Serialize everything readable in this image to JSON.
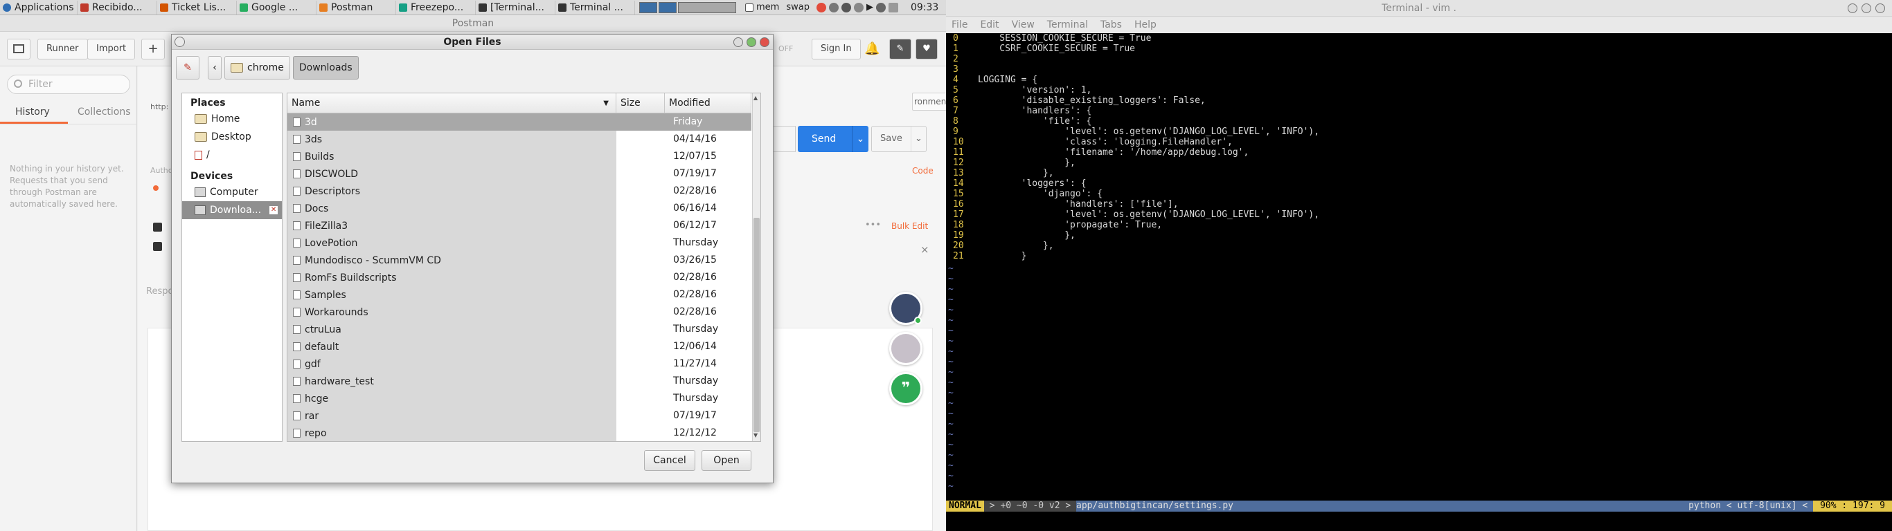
{
  "taskbar": {
    "apps": "Applications",
    "items": [
      {
        "label": "Recibido...",
        "color": "#c0392b"
      },
      {
        "label": "Ticket Lis...",
        "color": "#d35400"
      },
      {
        "label": "Google ...",
        "color": "#27ae60"
      },
      {
        "label": "Postman",
        "color": "#e67e22"
      },
      {
        "label": "Freezepo...",
        "color": "#16a085"
      },
      {
        "label": "[Terminal...",
        "color": "#333333"
      },
      {
        "label": "Terminal ...",
        "color": "#333333"
      }
    ],
    "mem": "mem",
    "swap": "swap",
    "clock": "09:33"
  },
  "postman": {
    "title": "Postman",
    "runner": "Runner",
    "import": "Import",
    "signin": "Sign In",
    "off": "OFF",
    "filter_placeholder": "Filter",
    "tab_history": "History",
    "tab_collections": "Collections",
    "empty": "Nothing in your history yet. Requests that you send through Postman are automatically saved here.",
    "send": "Send",
    "save": "Save",
    "code": "Code",
    "bulk_edit": "Bulk Edit",
    "environment": "ronment",
    "url_partial": "http:",
    "auth_partial": "Authc",
    "resp_partial": "Respo"
  },
  "dialog": {
    "title": "Open Files",
    "path": [
      "chrome",
      "Downloads"
    ],
    "places_header": "Places",
    "places": [
      "Home",
      "Desktop",
      "/"
    ],
    "devices_header": "Devices",
    "devices": [
      "Computer",
      "Downloa..."
    ],
    "columns": {
      "name": "Name",
      "size": "Size",
      "modified": "Modified"
    },
    "files": [
      {
        "name": "3d",
        "modified": "Friday"
      },
      {
        "name": "3ds",
        "modified": "04/14/16"
      },
      {
        "name": "Builds",
        "modified": "12/07/15"
      },
      {
        "name": "DISCWOLD",
        "modified": "07/19/17"
      },
      {
        "name": "Descriptors",
        "modified": "02/28/16"
      },
      {
        "name": "Docs",
        "modified": "06/16/14"
      },
      {
        "name": "FileZilla3",
        "modified": "06/12/17"
      },
      {
        "name": "LovePotion",
        "modified": "Thursday"
      },
      {
        "name": "Mundodisco - ScummVM CD",
        "modified": "03/26/15"
      },
      {
        "name": "RomFs Buildscripts",
        "modified": "02/28/16"
      },
      {
        "name": "Samples",
        "modified": "02/28/16"
      },
      {
        "name": "Workarounds",
        "modified": "02/28/16"
      },
      {
        "name": "ctruLua",
        "modified": "Thursday"
      },
      {
        "name": "default",
        "modified": "12/06/14"
      },
      {
        "name": "gdf",
        "modified": "11/27/14"
      },
      {
        "name": "hardware_test",
        "modified": "Thursday"
      },
      {
        "name": "hcge",
        "modified": "Thursday"
      },
      {
        "name": "rar",
        "modified": "07/19/17"
      },
      {
        "name": "repo",
        "modified": "12/12/12"
      }
    ],
    "cancel": "Cancel",
    "open": "Open"
  },
  "terminal": {
    "title": "Terminal - vim .",
    "menu": [
      "File",
      "Edit",
      "View",
      "Terminal",
      "Tabs",
      "Help"
    ],
    "lines": [
      {
        "n": "0",
        "t": "    SESSION_COOKIE_SECURE = True"
      },
      {
        "n": "1",
        "t": "    CSRF_COOKIE_SECURE = True"
      },
      {
        "n": "2",
        "t": ""
      },
      {
        "n": "3",
        "t": ""
      },
      {
        "n": "4",
        "t": "LOGGING = {"
      },
      {
        "n": "5",
        "t": "        'version': 1,"
      },
      {
        "n": "6",
        "t": "        'disable_existing_loggers': False,"
      },
      {
        "n": "7",
        "t": "        'handlers': {"
      },
      {
        "n": "8",
        "t": "            'file': {"
      },
      {
        "n": "9",
        "t": "                'level': os.getenv('DJANGO_LOG_LEVEL', 'INFO'),"
      },
      {
        "n": "10",
        "t": "                'class': 'logging.FileHandler',"
      },
      {
        "n": "11",
        "t": "                'filename': '/home/app/debug.log',"
      },
      {
        "n": "12",
        "t": "                },"
      },
      {
        "n": "13",
        "t": "            },"
      },
      {
        "n": "14",
        "t": "        'loggers': {"
      },
      {
        "n": "15",
        "t": "            'django': {"
      },
      {
        "n": "16",
        "t": "                'handlers': ['file'],"
      },
      {
        "n": "17",
        "t": "                'level': os.getenv('DJANGO_LOG_LEVEL', 'INFO'),"
      },
      {
        "n": "18",
        "t": "                'propagate': True,"
      },
      {
        "n": "19",
        "t": "                },"
      },
      {
        "n": "20",
        "t": "            },"
      },
      {
        "n": "21",
        "t": "        }"
      }
    ],
    "status": {
      "mode": "NORMAL",
      "git": " > +0 ~0 -0 v2 > ",
      "file": "app/authbigtincan/settings.py",
      "lang": "python < utf-8[unix] < ",
      "pos": "90% : 197: 9"
    }
  }
}
